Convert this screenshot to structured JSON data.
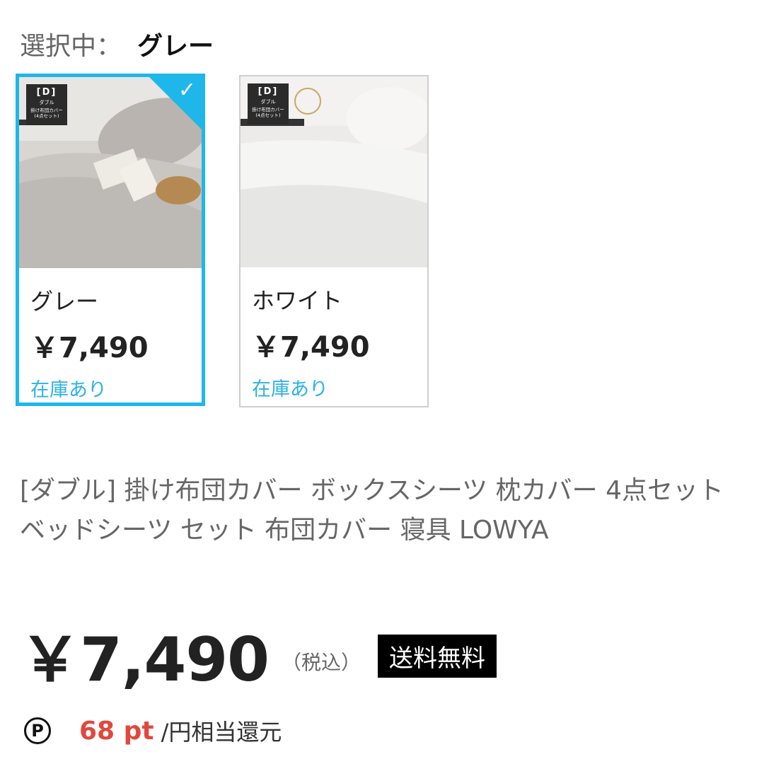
{
  "selection": {
    "label": "選択中：",
    "value": "グレー"
  },
  "variants": [
    {
      "name": "グレー",
      "price": "￥7,490",
      "stock": "在庫あり",
      "selected": true,
      "badge": {
        "size": "[D]",
        "size_name": "ダブル",
        "product": "掛け布団カバー\n(4点セット)"
      },
      "check": "✓"
    },
    {
      "name": "ホワイト",
      "price": "￥7,490",
      "stock": "在庫あり",
      "selected": false,
      "badge": {
        "size": "[D]",
        "size_name": "ダブル",
        "product": "掛け布団カバー\n(4点セット)"
      }
    }
  ],
  "product": {
    "title": "[ダブル] 掛け布団カバー ボックスシーツ 枕カバー 4点セット ベッドシーツ セット 布団カバー 寝具  LOWYA",
    "price": "￥7,490",
    "tax_note": "（税込）",
    "shipping_badge": "送料無料"
  },
  "points": {
    "icon_label": "P",
    "amount": "68 pt",
    "suffix": "/円相当還元"
  },
  "colors": {
    "accent": "#1fb7ea",
    "points": "#e0483e",
    "stock": "#2bb3e3"
  }
}
